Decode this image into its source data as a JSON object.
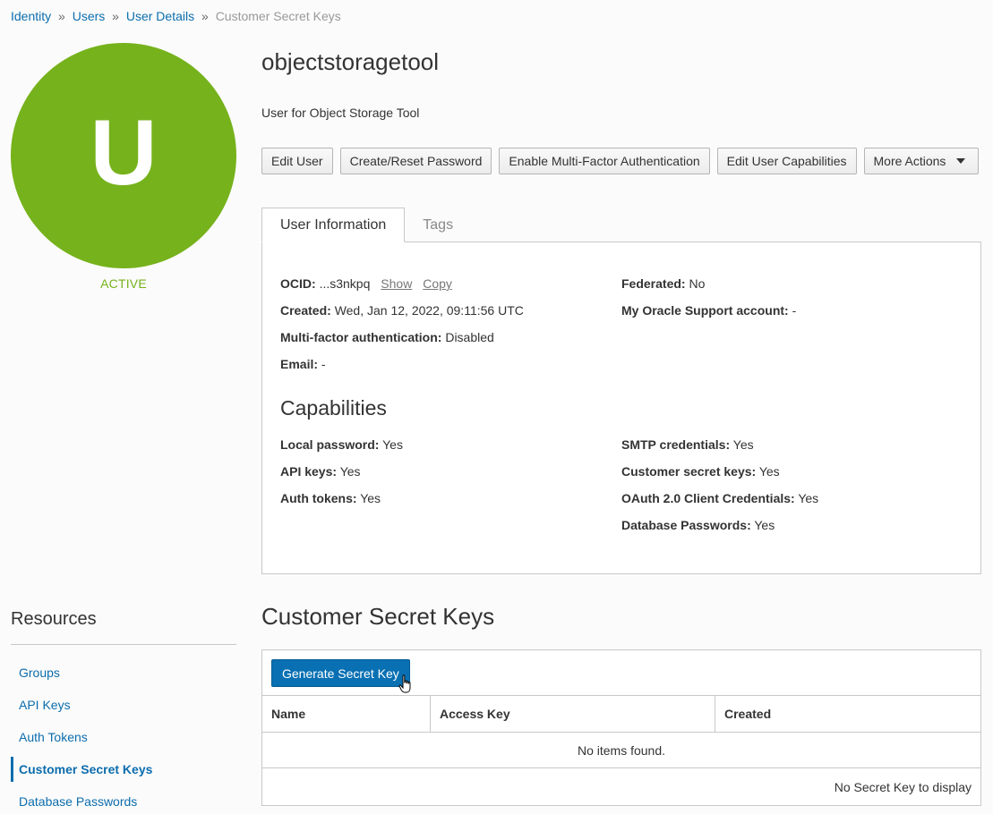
{
  "breadcrumb": {
    "items": [
      "Identity",
      "Users",
      "User Details"
    ],
    "separator": "»",
    "current": "Customer Secret Keys"
  },
  "avatar": {
    "letter": "U",
    "color": "#76b21c",
    "status": "ACTIVE"
  },
  "user": {
    "name": "objectstoragetool",
    "description": "User for Object Storage Tool"
  },
  "actions": {
    "edit_user": "Edit User",
    "reset_password": "Create/Reset Password",
    "enable_mfa": "Enable Multi-Factor Authentication",
    "edit_capabilities": "Edit User Capabilities",
    "more_actions": "More Actions",
    "more_actions_icon": "caret-down-icon"
  },
  "tabs": [
    {
      "label": "User Information",
      "active": true
    },
    {
      "label": "Tags",
      "active": false
    }
  ],
  "user_info": {
    "ocid_label": "OCID:",
    "ocid_value": "...s3nkpq",
    "show_link": "Show",
    "copy_link": "Copy",
    "created_label": "Created:",
    "created_value": "Wed, Jan 12, 2022, 09:11:56 UTC",
    "mfa_label": "Multi-factor authentication:",
    "mfa_value": "Disabled",
    "email_label": "Email:",
    "email_value": "-",
    "federated_label": "Federated:",
    "federated_value": "No",
    "support_label": "My Oracle Support account:",
    "support_value": "-"
  },
  "capabilities": {
    "title": "Capabilities",
    "local_password_label": "Local password:",
    "local_password_value": "Yes",
    "api_keys_label": "API keys:",
    "api_keys_value": "Yes",
    "auth_tokens_label": "Auth tokens:",
    "auth_tokens_value": "Yes",
    "smtp_label": "SMTP credentials:",
    "smtp_value": "Yes",
    "secret_keys_label": "Customer secret keys:",
    "secret_keys_value": "Yes",
    "oauth_label": "OAuth 2.0 Client Credentials:",
    "oauth_value": "Yes",
    "db_passwords_label": "Database Passwords:",
    "db_passwords_value": "Yes"
  },
  "resources": {
    "title": "Resources",
    "items": [
      {
        "label": "Groups",
        "active": false
      },
      {
        "label": "API Keys",
        "active": false
      },
      {
        "label": "Auth Tokens",
        "active": false
      },
      {
        "label": "Customer Secret Keys",
        "active": true
      },
      {
        "label": "Database Passwords",
        "active": false
      }
    ]
  },
  "secret_keys": {
    "title": "Customer Secret Keys",
    "generate_button": "Generate Secret Key",
    "columns": [
      "Name",
      "Access Key",
      "Created"
    ],
    "empty_message": "No items found.",
    "footer": "No Secret Key to display"
  },
  "colors": {
    "link": "#0c6dad",
    "primary_button": "#0870b3",
    "active_status": "#76b21c"
  }
}
